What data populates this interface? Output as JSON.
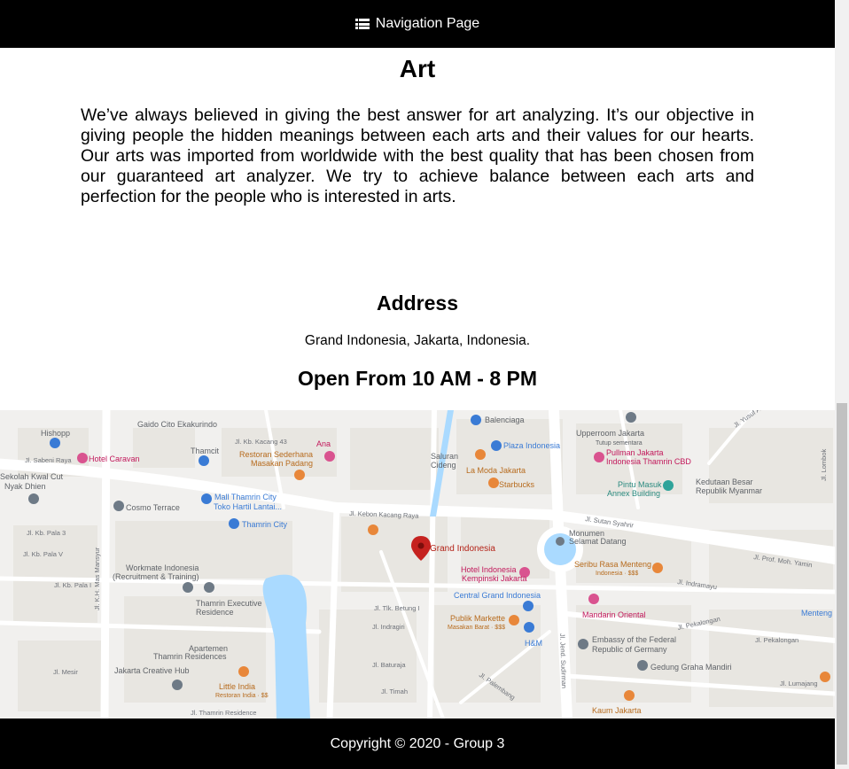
{
  "navbar": {
    "icon": "list-icon",
    "label": "Navigation Page"
  },
  "art": {
    "title": "Art",
    "description": "We’ve always believed in giving the best answer for art analyzing. It’s our objective in giving people the hidden meanings between each arts and their values for our hearts. Our arts was imported from worldwide with the best quality that has been chosen from our guaranteed art analyzer. We try to achieve balance between each arts and perfection for the people who is interested in arts."
  },
  "address": {
    "heading": "Address",
    "text": "Grand Indonesia, Jakarta, Indonesia.",
    "hours": "Open From 10 AM - 8 PM"
  },
  "map": {
    "marker_label": "Grand Indonesia",
    "pois": [
      "Hishopp",
      "Hotel Caravan",
      "Gaido Cito Ekakurindo",
      "Thamcit",
      "Restoran Sederhana Masakan Padang",
      "Ana",
      "Balenciaga",
      "Plaza Indonesia",
      "La Moda Jakarta",
      "Starbucks",
      "Upperroom Jakarta",
      "Tutup sementara",
      "Pullman Jakarta Indonesia Thamrin CBD",
      "Pintu Masuk Annex Building",
      "Kedutaan Besar Republik Myanmar",
      "Mall Thamrin City",
      "Toko Hartil Lantai...",
      "Cosmo Terrace",
      "Thamrin City",
      "Sekolah Kwal Cut Nyak Dhien",
      "Monumen Selamat Datang",
      "Seribu Rasa Menteng",
      "Indonesia · $$$",
      "Workmate Indonesia (Recruitment & Training)",
      "Hotel Indonesia Kempinski Jakarta",
      "Central Grand Indonesia",
      "Thamrin Executive Residence",
      "Publik Markette",
      "Masakan Barat · $$$",
      "H&M",
      "Mandarin Oriental",
      "Menteng",
      "Embassy of the Federal Republic of Germany",
      "Gedung Graha Mandiri",
      "Apartemen Thamrin Residences",
      "Jakarta Creative Hub",
      "Little India",
      "Restoran India · $$",
      "Kaum Jakarta",
      "Saluran Cideng"
    ],
    "roads": [
      "Jl. Kebon Kacang Raya",
      "Jl. Kebon Kacang",
      "Jl. Kb. Kacang 43",
      "Jl. Sabeni Raya",
      "Jl. Kb. Pala 3",
      "Jl. Kb. Pala V",
      "Jl. Kb. Pala I",
      "Jl. K.H. Mas Mansyur",
      "Jl. Tlk. Betung I",
      "Jl. Tlk. Betung",
      "Jl. Sutan Syahrir",
      "Jl. Prof. Moh. Yamin",
      "Jl. Imam Bonjol",
      "Jl. Pekalongan",
      "Jl. Indramayu",
      "Jl. Jend. Sudirman",
      "Jl. Thamrin Residence",
      "Jl. Tlk. Indragiri",
      "Jl. Baturaja",
      "Jl. Timah",
      "Jl. Palembang",
      "Jl. Tasikmalaya",
      "Jl. Lumajang",
      "Jl. Malang",
      "Jl. Lombok",
      "Jl. Yusuf Adiwinata",
      "Jl. Mesir",
      "Jl. Bangka",
      "Jl. Sumenep"
    ],
    "colors": {
      "land": "#f1f0ee",
      "block": "#e8e6e1",
      "road": "#ffffff",
      "water": "#aadaff",
      "marker": "#c5221f",
      "shop": "#3a7bd5",
      "food": "#e8873a",
      "pink": "#d9538f",
      "grey": "#6e7a86"
    }
  },
  "footer": {
    "copyright": "Copyright © 2020 - Group 3"
  }
}
